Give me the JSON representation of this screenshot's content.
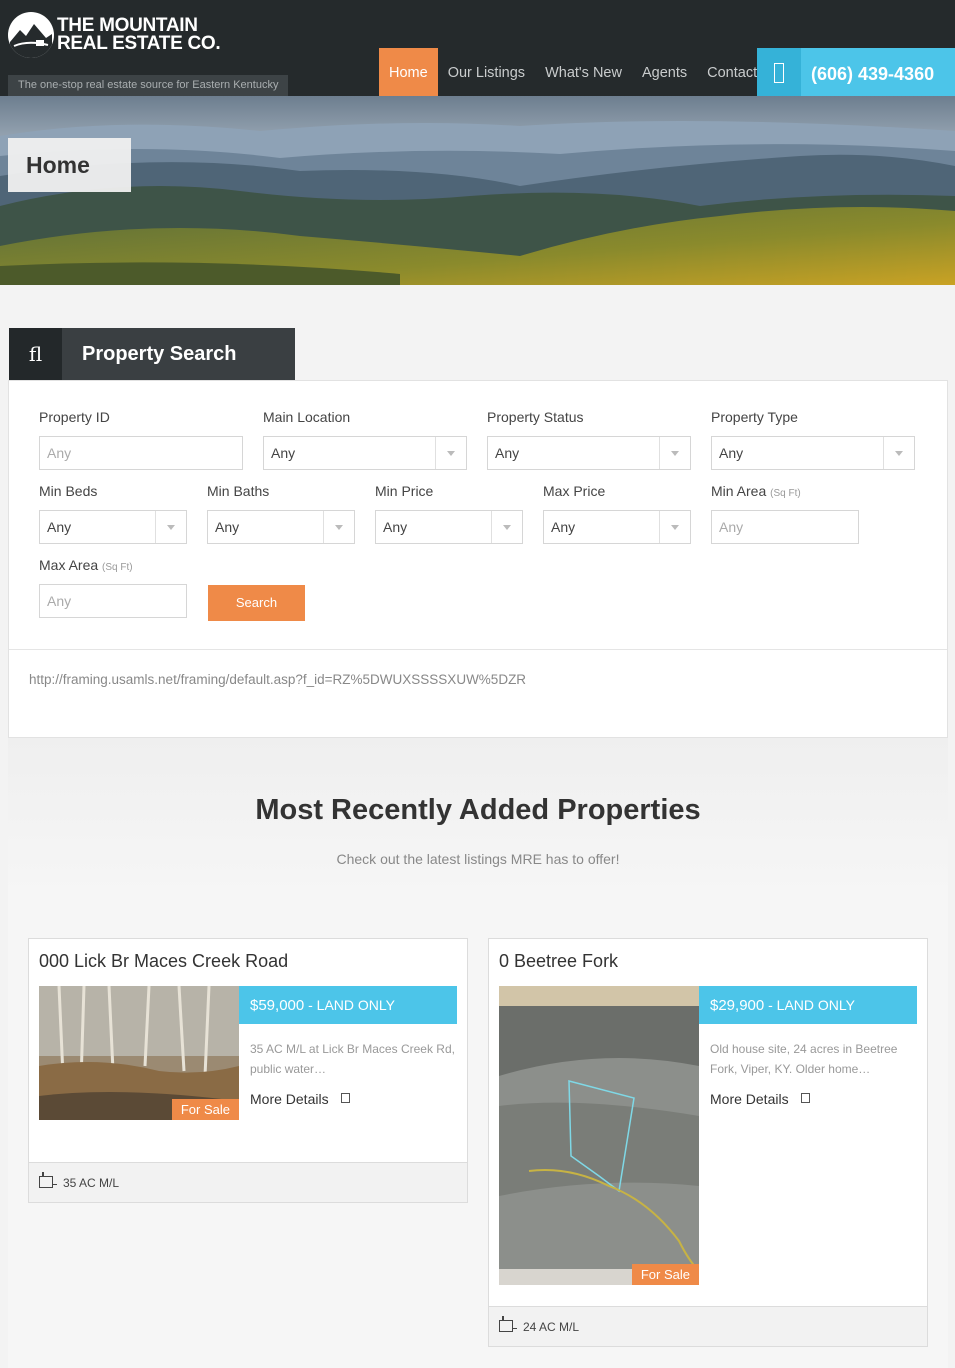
{
  "header": {
    "logo_line1": "THE MOUNTAIN",
    "logo_line2": "REAL ESTATE CO.",
    "tagline": "The one-stop real estate source for Eastern Kentucky",
    "nav": [
      "Home",
      "Our Listings",
      "What's New",
      "Agents",
      "Contact"
    ],
    "active_nav": "Home",
    "phone_icon_glyph": "☰",
    "phone": "(606) 439-4360"
  },
  "hero": {
    "page_title": "Home"
  },
  "search": {
    "tab_icon": "fl",
    "title": "Property Search",
    "fields": {
      "property_id": {
        "label": "Property ID",
        "placeholder": "Any"
      },
      "main_location": {
        "label": "Main Location",
        "value": "Any"
      },
      "property_status": {
        "label": "Property Status",
        "value": "Any"
      },
      "property_type": {
        "label": "Property Type",
        "value": "Any"
      },
      "min_beds": {
        "label": "Min Beds",
        "value": "Any"
      },
      "min_baths": {
        "label": "Min Baths",
        "value": "Any"
      },
      "min_price": {
        "label": "Min Price",
        "value": "Any"
      },
      "max_price": {
        "label": "Max Price",
        "value": "Any"
      },
      "min_area": {
        "label": "Min Area",
        "unit": "(Sq Ft)",
        "placeholder": "Any"
      },
      "max_area": {
        "label": "Max Area",
        "unit": "(Sq Ft)",
        "placeholder": "Any"
      }
    },
    "button": "Search",
    "framing_url": "http://framing.usamls.net/framing/default.asp?f_id=RZ%5DWUXSSSSXUW%5DZR"
  },
  "recent": {
    "title": "Most Recently Added Properties",
    "subtitle": "Check out the latest listings MRE has to offer!",
    "listings": [
      {
        "title": "000 Lick Br Maces Creek Road",
        "price": "$59,000",
        "type": " - LAND ONLY",
        "status": "For Sale",
        "description": "35 AC M/L at Lick Br Maces Creek Rd, public water…",
        "more": "More Details",
        "area": "35 AC M/L"
      },
      {
        "title": "0 Beetree Fork",
        "price": "$29,900",
        "type": " - LAND ONLY",
        "status": "For Sale",
        "description": "Old house site, 24 acres in Beetree Fork, Viper, KY. Older home…",
        "more": "More Details",
        "area": "24  AC M/L"
      }
    ]
  },
  "colors": {
    "accent_orange": "#ef8a48",
    "accent_blue": "#4cc5e9",
    "header_dark": "#252a2c"
  }
}
